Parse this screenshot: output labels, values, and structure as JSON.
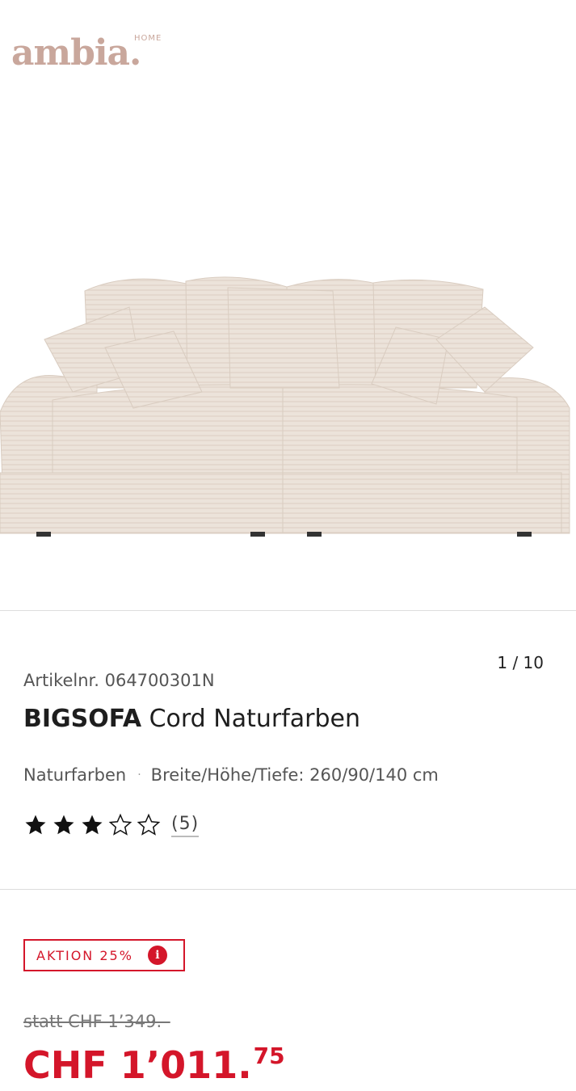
{
  "brand": {
    "logo_text": "ambia.",
    "logo_subtext": "HOME",
    "logo_color": "#c9a79c"
  },
  "gallery": {
    "image_alt": "Bigsofa Cord Naturfarben",
    "counter": "1 / 10"
  },
  "product": {
    "article_number": "Artikelnr. 064700301N",
    "title_bold": "BIGSOFA",
    "title_rest": "Cord Naturfarben",
    "color": "Naturfarben",
    "dimensions": "Breite/Höhe/Tiefe: 260/90/140 cm",
    "rating": {
      "value": 3,
      "max": 5,
      "count_label": "(5)"
    }
  },
  "pricing": {
    "badge_label": "AKTION 25%",
    "badge_info_icon": "i",
    "old_price": "statt CHF 1’349.–",
    "price_main": "CHF 1’011.",
    "price_cents": "75",
    "accent_color": "#d4162a"
  }
}
